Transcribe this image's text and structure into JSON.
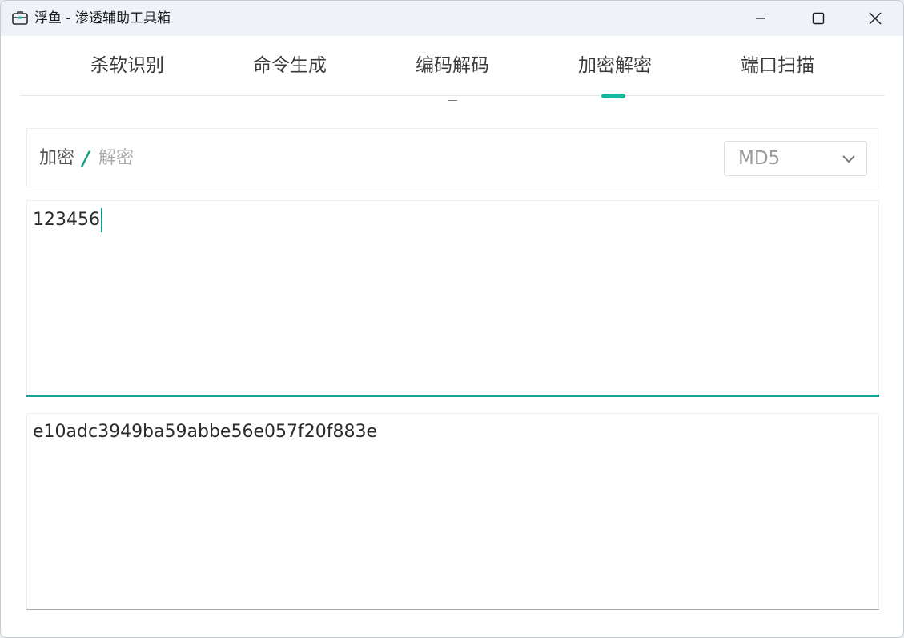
{
  "window": {
    "title": "浮鱼 - 渗透辅助工具箱",
    "icon": "toolbox-icon",
    "controls": [
      "minimize-icon",
      "maximize-icon",
      "close-icon"
    ]
  },
  "tabs": [
    {
      "label": "杀软识别"
    },
    {
      "label": "命令生成"
    },
    {
      "label": "编码解码"
    },
    {
      "label": "加密解密",
      "active": true
    },
    {
      "label": "端口扫描"
    }
  ],
  "mode": {
    "encrypt_label": "加密",
    "separator": "/",
    "decrypt_label": "解密",
    "active": "encrypt"
  },
  "algorithm": {
    "selected": "MD5"
  },
  "input": {
    "value": "123456"
  },
  "output": {
    "value": "e10adc3949ba59abbe56e057f20f883e"
  },
  "colors": {
    "accent": "#14b89a",
    "underline": "#14a592"
  }
}
